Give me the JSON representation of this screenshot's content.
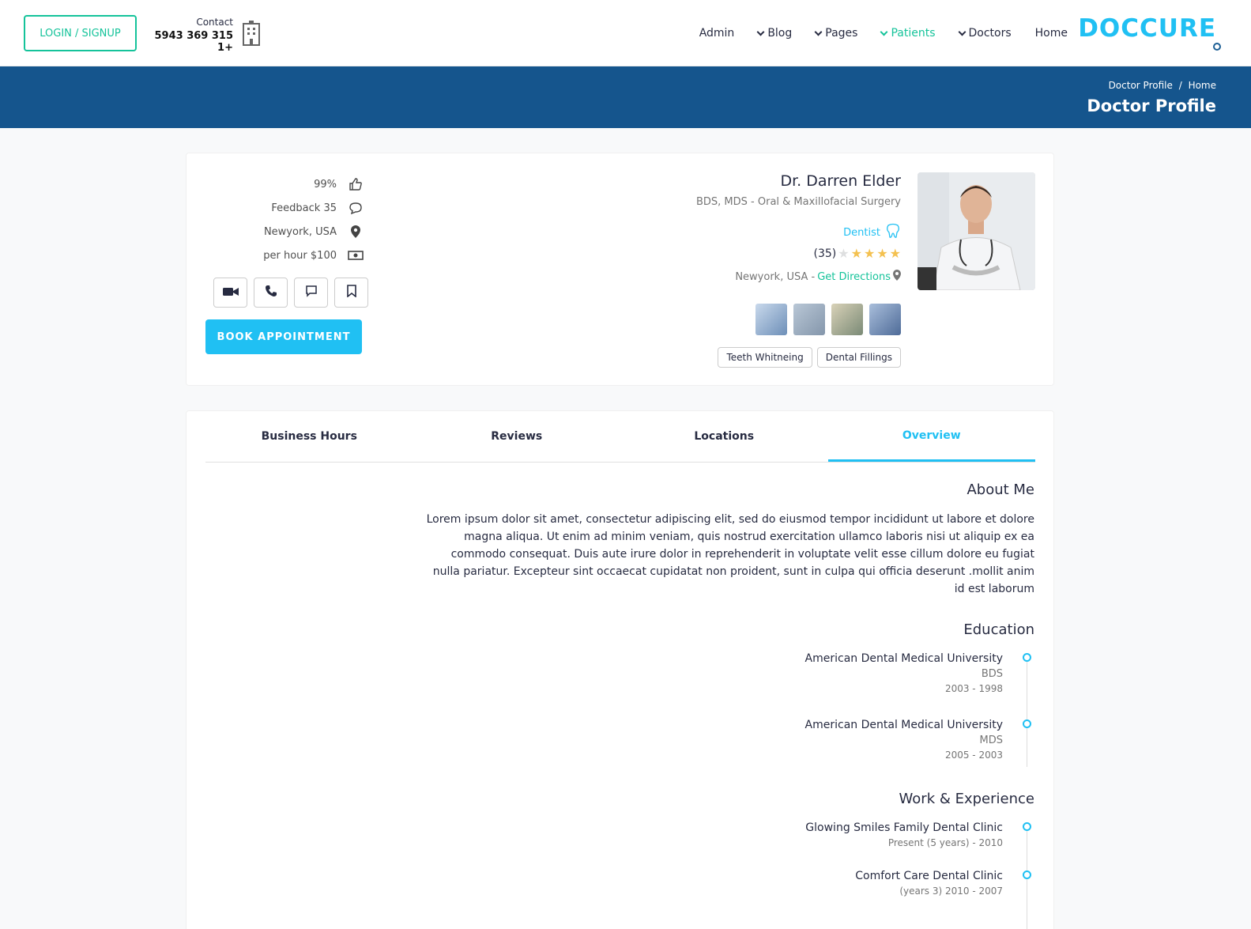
{
  "header": {
    "login_label": "LOGIN / SIGNUP",
    "contact_label": "Contact",
    "contact_number": "5943 369 315 1+",
    "nav": [
      "Admin",
      "Blog",
      "Pages",
      "Patients",
      "Doctors",
      "Home"
    ],
    "logo_text": "DOCCURE"
  },
  "banner": {
    "crumb_current": "Doctor Profile",
    "crumb_sep": "/",
    "crumb_home": "Home",
    "title": "Doctor Profile"
  },
  "profile": {
    "name": "Dr. Darren Elder",
    "degree": "BDS, MDS - Oral & Maxillofacial Surgery",
    "speciality": "Dentist",
    "rating_count": "(35)",
    "rating_stars": 4,
    "location": "Newyork, USA -",
    "directions": "Get Directions",
    "tags": [
      "Teeth Whitneing",
      "Dental Fillings"
    ],
    "stats": {
      "likes": "99%",
      "feedback": "Feedback 35",
      "location": "Newyork, USA",
      "price": "per hour $100"
    },
    "book_label": "BOOK APPOINTMENT"
  },
  "tabs": [
    "Business Hours",
    "Reviews",
    "Locations",
    "Overview"
  ],
  "overview": {
    "about_title": "About Me",
    "about_text": "Lorem ipsum dolor sit amet, consectetur adipiscing elit, sed do eiusmod tempor incididunt ut labore et dolore magna aliqua. Ut enim ad minim veniam, quis nostrud exercitation ullamco laboris nisi ut aliquip ex ea commodo consequat. Duis aute irure dolor in reprehenderit in voluptate velit esse cillum dolore eu fugiat nulla pariatur. Excepteur sint occaecat cupidatat non proident, sunt in culpa qui officia deserunt .mollit anim id est laborum",
    "education_title": "Education",
    "education": [
      {
        "name": "American Dental Medical University",
        "degree": "BDS",
        "years": "2003 - 1998"
      },
      {
        "name": "American Dental Medical University",
        "degree": "MDS",
        "years": "2005 - 2003"
      }
    ],
    "work_title": "Work & Experience",
    "work": [
      {
        "name": "Glowing Smiles Family Dental Clinic",
        "years": "Present (5 years) - 2010"
      },
      {
        "name": "Comfort Care Dental Clinic",
        "years": "(years 3) 2010 - 2007"
      }
    ]
  }
}
